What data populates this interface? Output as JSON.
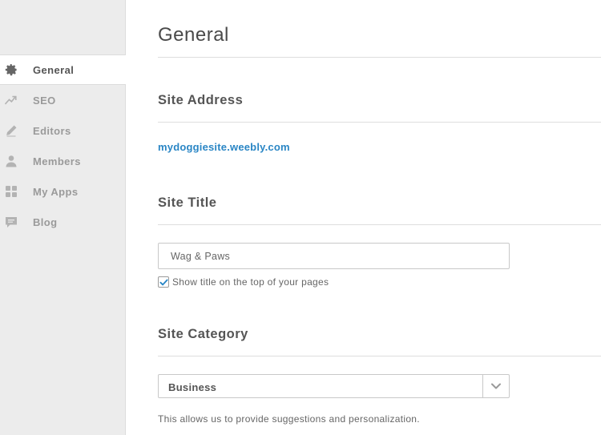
{
  "sidebar": {
    "items": [
      {
        "label": "General",
        "icon": "gear-icon",
        "active": true
      },
      {
        "label": "SEO",
        "icon": "trending-up-icon",
        "active": false
      },
      {
        "label": "Editors",
        "icon": "pencil-icon",
        "active": false
      },
      {
        "label": "Members",
        "icon": "person-icon",
        "active": false
      },
      {
        "label": "My Apps",
        "icon": "grid-icon",
        "active": false
      },
      {
        "label": "Blog",
        "icon": "comment-icon",
        "active": false
      }
    ]
  },
  "main": {
    "title": "General",
    "site_address": {
      "heading": "Site Address",
      "url": "mydoggiesite.weebly.com"
    },
    "site_title": {
      "heading": "Site Title",
      "value": "Wag & Paws",
      "show_title_checked": true,
      "show_title_label": "Show title on the top of your pages"
    },
    "site_category": {
      "heading": "Site Category",
      "selected": "Business",
      "help_text": "This allows us to provide suggestions and personalization."
    }
  },
  "colors": {
    "sidebar_bg": "#ececec",
    "link": "#2a86c5",
    "checkmark": "#2a86c5"
  }
}
